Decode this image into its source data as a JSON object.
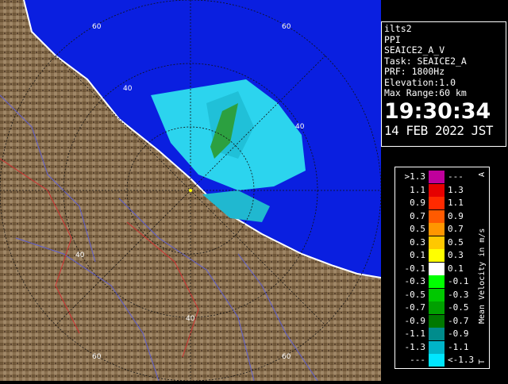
{
  "info": {
    "radar_name": "ilts2",
    "mode": "PPI",
    "product": "SEAICE2_A_V",
    "task": "Task: SEAICE2_A",
    "prf": "PRF: 1800Hz",
    "elevation": "Elevation:1.0",
    "max_range": "Max Range:60 km",
    "time": "19:30:34",
    "date": "14 FEB 2022 JST"
  },
  "ring_labels": {
    "r60_top": "60",
    "r60_right": "60",
    "r40_top": "40",
    "r40_right": "40",
    "r40_left": "40",
    "r40_bottom": "40",
    "r60_bottom_left": "60",
    "r60_bottom_right": "60"
  },
  "legend": {
    "unit_label": "Mean Velocity in m/s",
    "corner_top": "A",
    "corner_bottom": "T",
    "rows": [
      {
        "low": ">1.3",
        "high": "---",
        "color": "#c0009c"
      },
      {
        "low": "1.1",
        "high": "1.3",
        "color": "#e60000"
      },
      {
        "low": "0.9",
        "high": "1.1",
        "color": "#ff2a00"
      },
      {
        "low": "0.7",
        "high": "0.9",
        "color": "#ff5a00"
      },
      {
        "low": "0.5",
        "high": "0.7",
        "color": "#ff9600"
      },
      {
        "low": "0.3",
        "high": "0.5",
        "color": "#ffc800"
      },
      {
        "low": "0.1",
        "high": "0.3",
        "color": "#ffff00"
      },
      {
        "low": "-0.1",
        "high": "0.1",
        "color": "#ffffff"
      },
      {
        "low": "-0.3",
        "high": "-0.1",
        "color": "#00ff00"
      },
      {
        "low": "-0.5",
        "high": "-0.3",
        "color": "#00c800"
      },
      {
        "low": "-0.7",
        "high": "-0.5",
        "color": "#00a000"
      },
      {
        "low": "-0.9",
        "high": "-0.7",
        "color": "#007800"
      },
      {
        "low": "-1.1",
        "high": "-0.9",
        "color": "#008c8c"
      },
      {
        "low": "-1.3",
        "high": "-1.1",
        "color": "#00b4c8"
      },
      {
        "low": "---",
        "high": "<-1.3",
        "color": "#00e6ff"
      }
    ]
  },
  "colors": {
    "sea": "#0a1fe0",
    "land": "#8a7050",
    "coast": "#ffffff",
    "echo_light": "#30e8f0",
    "echo_mid": "#20c0d8",
    "rivers": "#6060d0",
    "borders": "#d03030"
  }
}
